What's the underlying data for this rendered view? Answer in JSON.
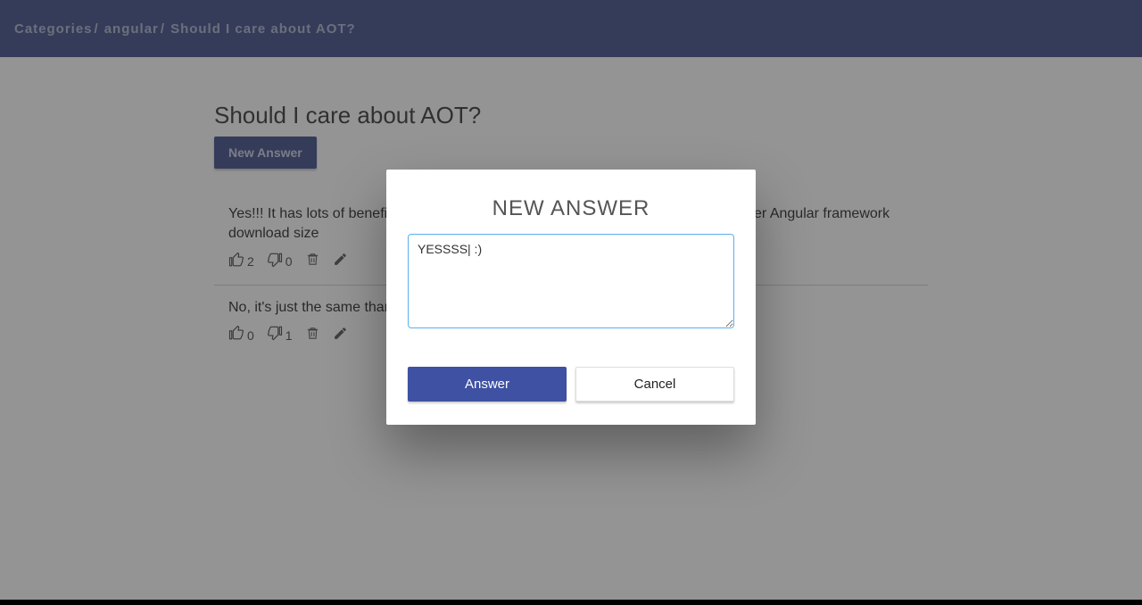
{
  "breadcrumb": {
    "root": "Categories",
    "category": "angular",
    "current": "Should I care about AOT?"
  },
  "page": {
    "title": "Should I care about AOT?",
    "new_answer_label": "New Answer"
  },
  "answers": [
    {
      "text": "Yes!!! It has lots of benefits: Faster rendering, Fewer asynchronous requests, Smaller Angular framework download size",
      "up": "2",
      "down": "0"
    },
    {
      "text": "No, it's just the same than JIT",
      "up": "0",
      "down": "1"
    }
  ],
  "modal": {
    "title": "NEW ANSWER",
    "value": "YESSSS| :)",
    "submit": "Answer",
    "cancel": "Cancel"
  }
}
